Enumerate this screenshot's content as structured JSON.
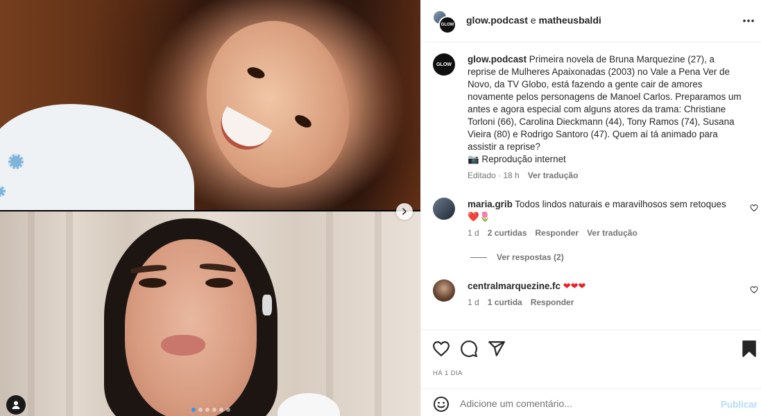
{
  "post": {
    "header_users": "glow.podcast",
    "header_conjunction": "e",
    "header_coauthor": "matheusbaldi",
    "glow_badge": "GLOW"
  },
  "caption": {
    "username": "glow.podcast",
    "text": "Primeira novela de Bruna Marquezine (27), a reprise de Mulheres Apaixonadas (2003) no Vale a Pena Ver de Novo, da TV Globo, está fazendo a gente cair de amores novamente pelos personagens de Manoel Carlos. Preparamos um antes e agora especial com alguns atores da trama: Christiane Torloni (66), Carolina Dieckmann (44), Tony Ramos (74), Susana Vieira (80) e Rodrigo Santoro (47). Quem aí tá animado para assistir a reprise?",
    "credit": "📷 Reprodução internet",
    "edited": "Editado · 18 h",
    "translate": "Ver tradução"
  },
  "comments": [
    {
      "username": "maria.grib",
      "text": "Todos lindos naturais e maravilhosos sem retoques",
      "emoji": "❤️🌷",
      "time": "1 d",
      "likes": "2 curtidas",
      "reply": "Responder",
      "translate": "Ver tradução",
      "view_replies": "Ver respostas (2)"
    },
    {
      "username": "centralmarquezine.fc",
      "text": "❤❤❤",
      "time": "1 d",
      "likes": "1 curtida",
      "reply": "Responder"
    }
  ],
  "footer": {
    "date": "HÁ 1 DIA",
    "comment_placeholder": "Adicione um comentário...",
    "publish_label": "Publicar"
  },
  "carousel": {
    "slide_count": 6,
    "active_index": 0
  },
  "colors": {
    "accent": "#0095f6",
    "publish_disabled": "#b3dbff",
    "muted_text": "#737373"
  },
  "icons": [
    "chevron-right-icon",
    "user-tag-icon",
    "more-horizontal-icon",
    "heart-icon",
    "comment-icon",
    "share-icon",
    "bookmark-icon",
    "emoji-icon"
  ]
}
